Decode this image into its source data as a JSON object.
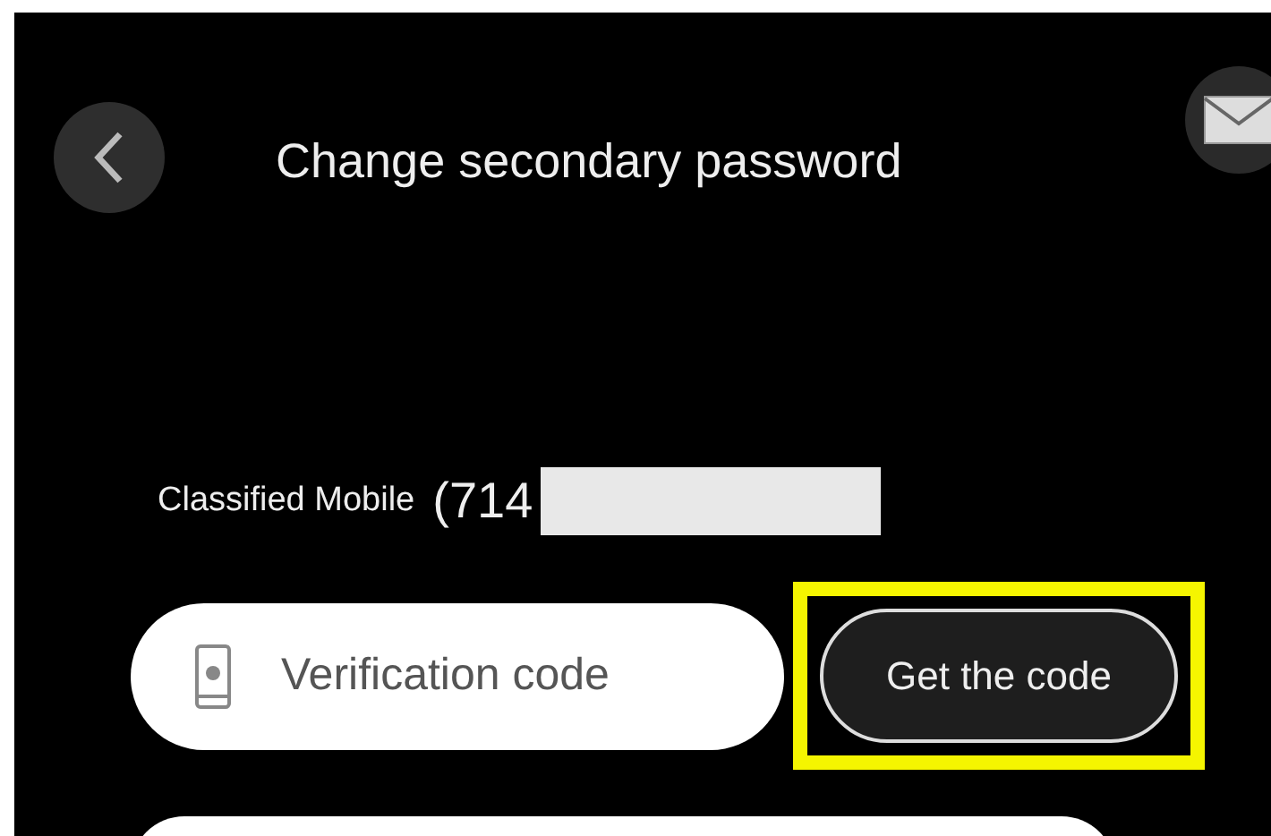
{
  "header": {
    "title": "Change secondary password"
  },
  "mobile": {
    "label": "Classified Mobile",
    "value": "(714"
  },
  "code_field": {
    "placeholder": "Verification code"
  },
  "get_code_button": {
    "label": "Get the code",
    "highlighted": true
  }
}
